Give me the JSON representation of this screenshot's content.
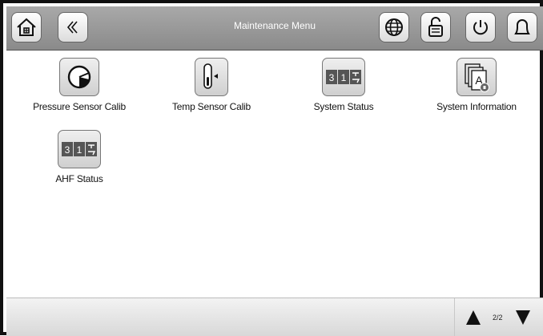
{
  "header": {
    "title": "Maintenance Menu",
    "buttons": {
      "home": "home-icon",
      "back": "back-icon",
      "language": "globe-icon",
      "lock": "unlock-icon",
      "power": "power-icon",
      "alarm": "bell-icon"
    }
  },
  "main": {
    "tiles": [
      {
        "label": "Pressure Sensor Calib",
        "icon": "gauge-icon"
      },
      {
        "label": "Temp Sensor Calib",
        "icon": "thermometer-icon"
      },
      {
        "label": "System Status",
        "icon": "counter-icon",
        "digits": [
          "3",
          "1"
        ]
      },
      {
        "label": "System Information",
        "icon": "document-info-icon"
      },
      {
        "label": "AHF Status",
        "icon": "counter-icon",
        "digits": [
          "3",
          "1"
        ]
      }
    ]
  },
  "footer": {
    "page_indicator": "2/2"
  }
}
